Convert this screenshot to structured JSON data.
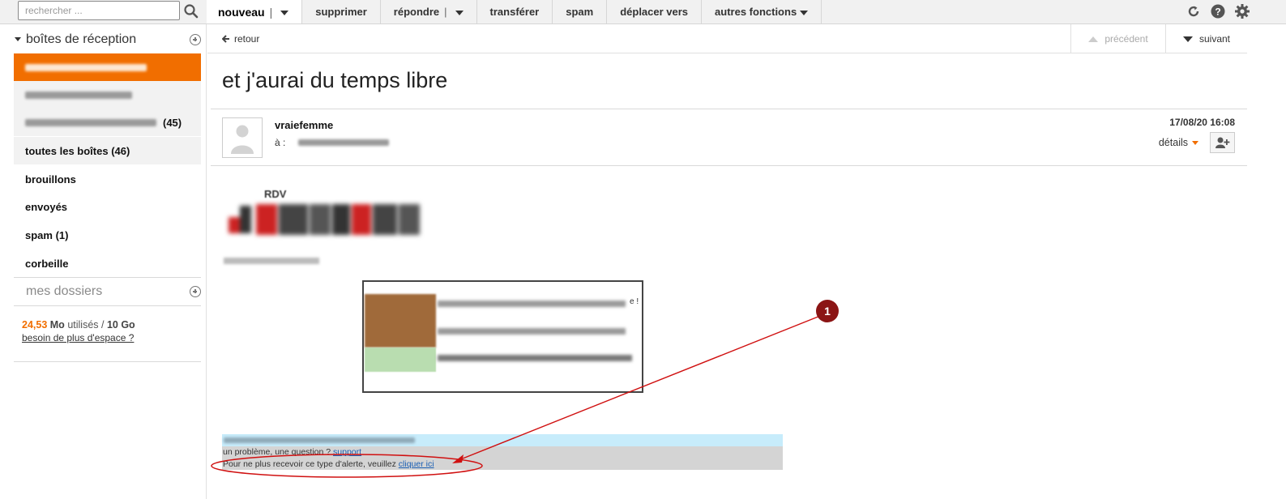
{
  "search": {
    "placeholder": "rechercher ..."
  },
  "toolbar": {
    "new_label": "nouveau",
    "new_sep": "|",
    "delete_label": "supprimer",
    "reply_label": "répondre",
    "reply_sep": "|",
    "forward_label": "transférer",
    "spam_label": "spam",
    "move_label": "déplacer vers",
    "more_label": "autres fonctions"
  },
  "sidebar": {
    "inboxes_title": "boîtes de réception",
    "boxes": [
      {
        "label": "",
        "count": ""
      },
      {
        "label": "",
        "count": ""
      },
      {
        "label": "",
        "count": "(45)"
      },
      {
        "label": "toutes les boîtes (46)",
        "count": ""
      }
    ],
    "folders": [
      {
        "label": "brouillons"
      },
      {
        "label": "envoyés"
      },
      {
        "label": "spam (1)"
      },
      {
        "label": "corbeille"
      }
    ],
    "my_folders_title": "mes dossiers",
    "quota": {
      "used_value": "24,53",
      "used_unit": "Mo",
      "used_text": "utilisés /",
      "total": "10 Go",
      "more_space_link": "besoin de plus d'espace ?"
    }
  },
  "message": {
    "back_label": "retour",
    "prev_label": "précédent",
    "next_label": "suivant",
    "subject": "et j'aurai du temps libre",
    "sender": "vraiefemme",
    "to_label": "à :",
    "date": "17/08/20 16:08",
    "details_label": "détails",
    "body": {
      "logo_text": "RDV",
      "card_line1_end": "e !"
    },
    "footer": {
      "problem_text": "un problème, une question ? ",
      "support_link": "support",
      "unsubscribe_text": "Pour ne plus recevoir ce type d'alerte, veuillez ",
      "unsubscribe_link": "cliquer ici"
    }
  },
  "annotation": {
    "marker": "1"
  },
  "colors": {
    "accent": "#f16e00",
    "annotation": "#d01010",
    "marker": "#8b1414"
  }
}
